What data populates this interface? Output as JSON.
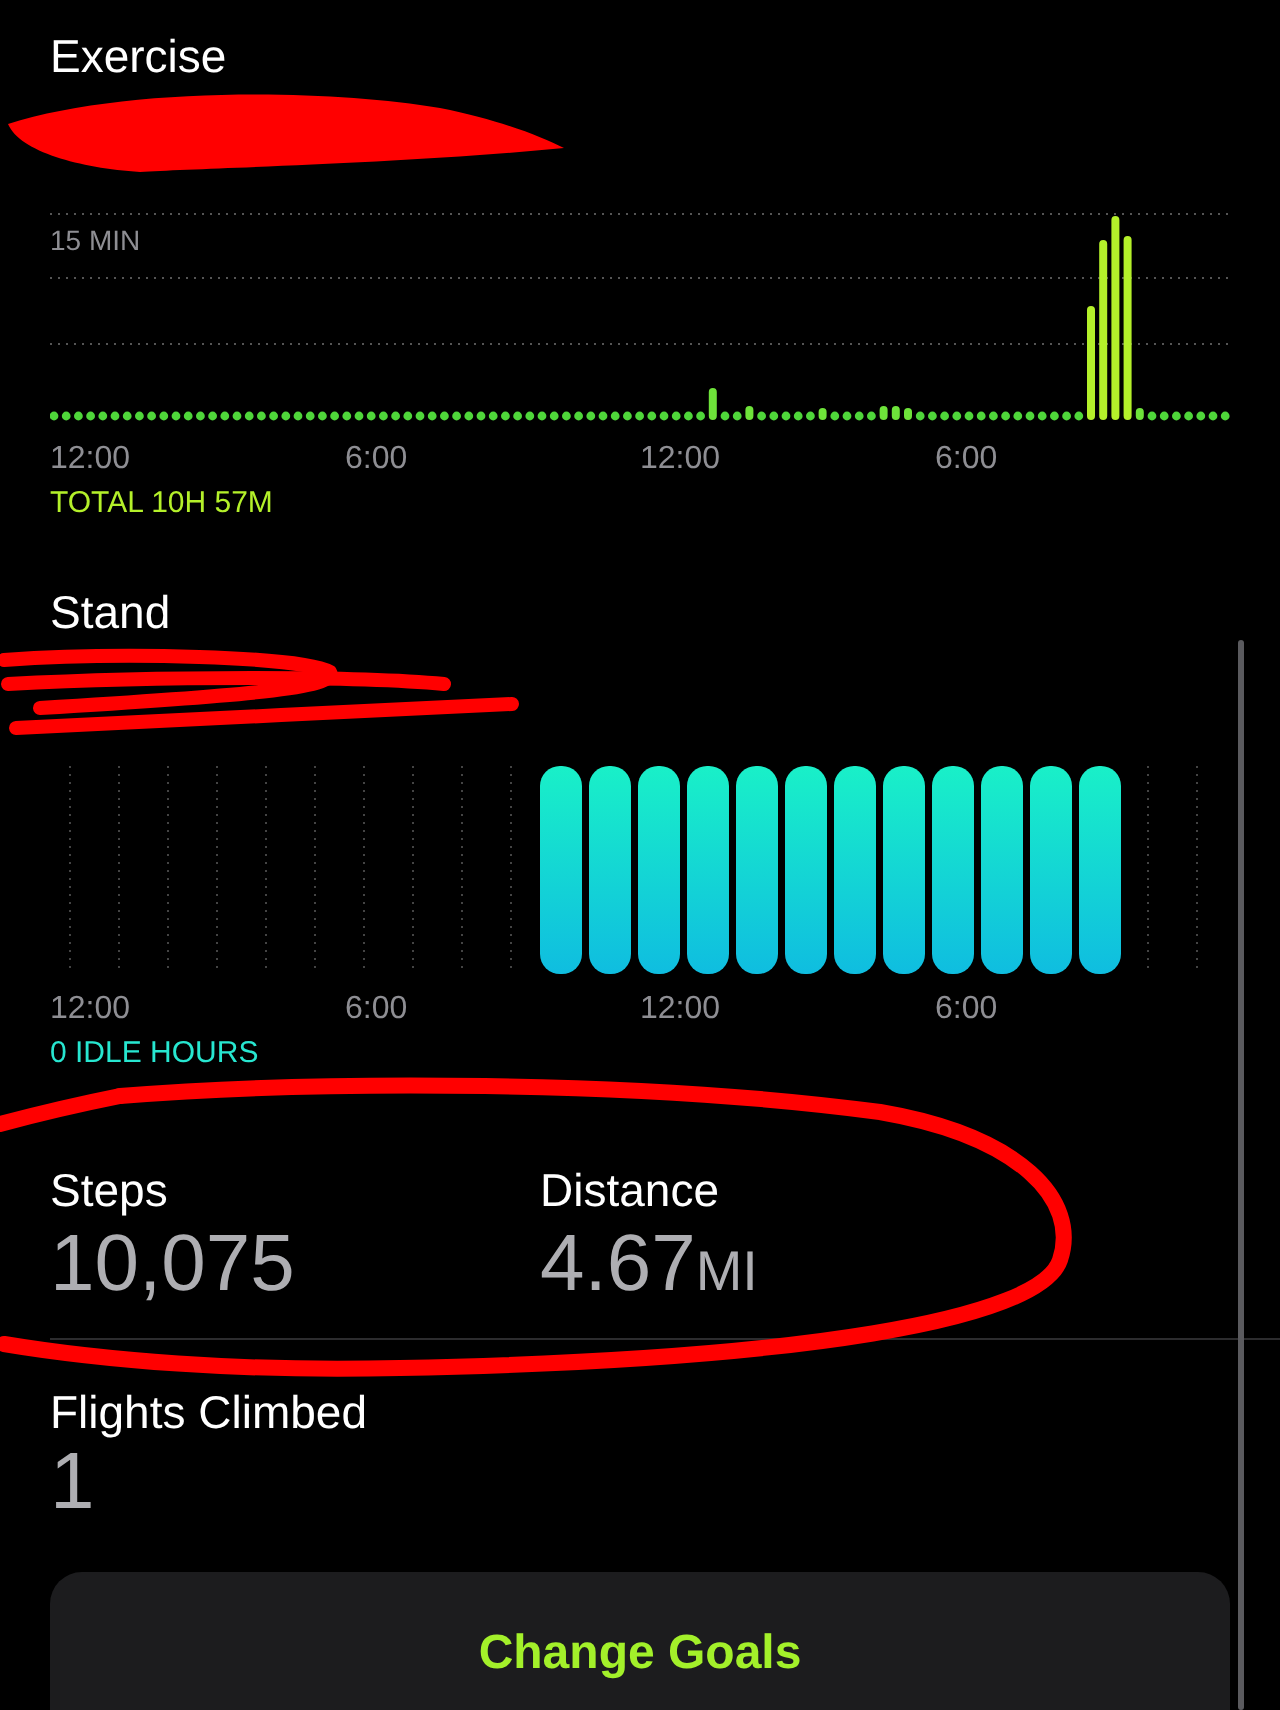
{
  "sections": [
    {
      "kind": "exercise",
      "title": "Exercise",
      "axis_label": "15 MIN",
      "x_labels": [
        "12:00",
        "6:00",
        "12:00",
        "6:00"
      ],
      "summary": "TOTAL 10H 57M"
    },
    {
      "kind": "stand",
      "title": "Stand",
      "x_labels": [
        "12:00",
        "6:00",
        "12:00",
        "6:00"
      ],
      "summary": "0 IDLE HOURS"
    }
  ],
  "metrics": [
    {
      "label": "Steps",
      "value": "10,075"
    },
    {
      "label": "Distance",
      "value": "4.67",
      "unit": "MI"
    }
  ],
  "flights": {
    "label": "Flights Climbed",
    "value": "1"
  },
  "button": {
    "label": "Change Goals"
  }
}
